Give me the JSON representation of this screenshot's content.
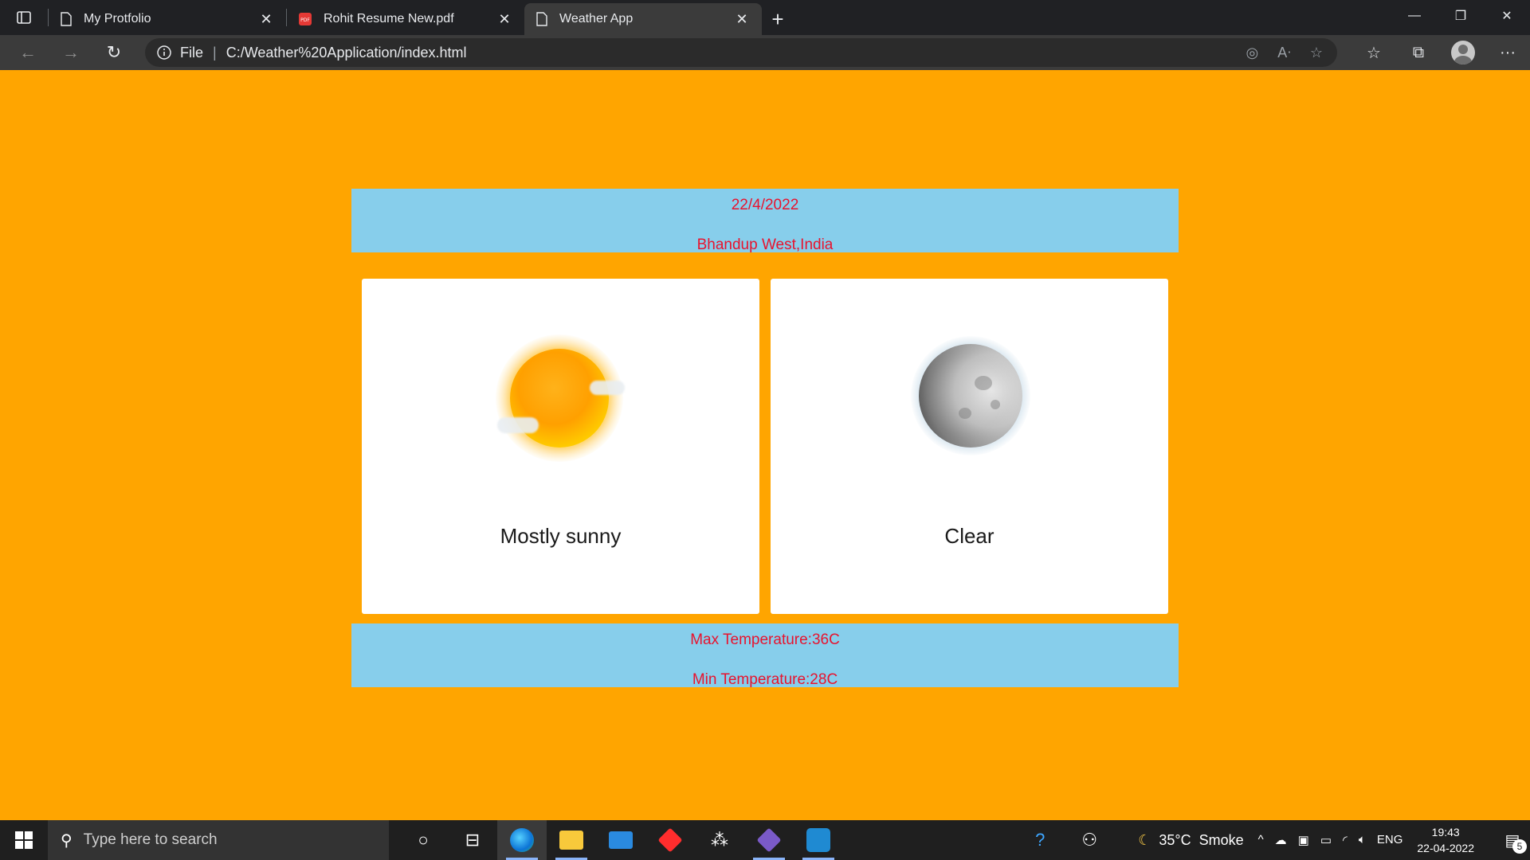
{
  "browser": {
    "tabs": [
      {
        "title": "My Protfolio",
        "icon": "page-icon",
        "active": false
      },
      {
        "title": "Rohit Resume New.pdf",
        "icon": "pdf-icon",
        "active": false
      },
      {
        "title": "Weather App",
        "icon": "page-icon",
        "active": true
      }
    ],
    "address": {
      "scheme_label": "File",
      "url": "C:/Weather%20Application/index.html"
    }
  },
  "weather": {
    "date": "22/4/2022",
    "location": "Bhandup West,India",
    "day": {
      "condition": "Mostly sunny",
      "icon": "sun-icon"
    },
    "night": {
      "condition": "Clear",
      "icon": "moon-icon"
    },
    "max_temp": "Max Temperature:36C",
    "min_temp": "Min Temperature:28C"
  },
  "taskbar": {
    "search_placeholder": "Type here to search",
    "weather_temp": "35°C",
    "weather_text": "Smoke",
    "language": "ENG",
    "time": "19:43",
    "date": "22-04-2022",
    "notification_count": "5"
  },
  "colors": {
    "page_background": "#ffa500",
    "info_box": "#87ceeb",
    "info_text": "#e8132e"
  }
}
